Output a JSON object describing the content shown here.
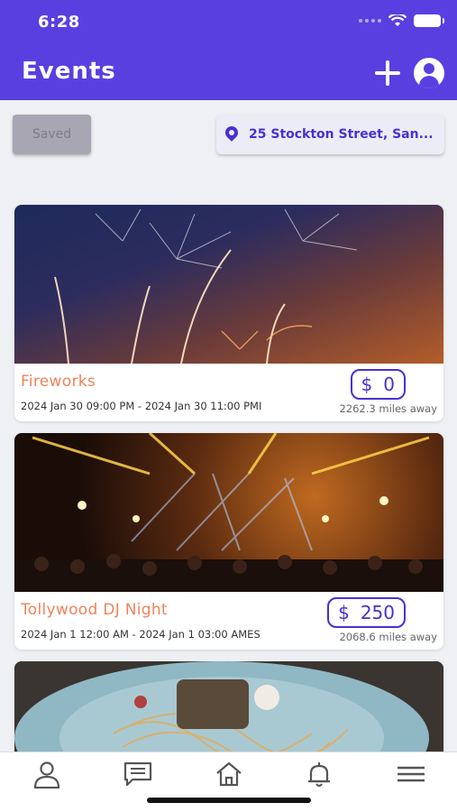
{
  "status_bar": {
    "time": "6:28"
  },
  "header": {
    "title": "Events"
  },
  "filters": {
    "saved_label": "Saved",
    "location": "25 Stockton Street, San..."
  },
  "events": [
    {
      "title": "Fireworks",
      "dates": "2024 Jan 30 09:00 PM  -  2024 Jan 30 11:00 PMI",
      "currency": "$",
      "price": "0",
      "distance": "2262.3  miles away"
    },
    {
      "title": "Tollywood DJ Night",
      "dates": "2024 Jan 1 12:00 AM  -  2024 Jan 1 03:00 AMES",
      "currency": "$",
      "price": "250",
      "distance": "2068.6  miles away"
    }
  ],
  "colors": {
    "header": "#5a3fe0",
    "accent": "#4a2fd4",
    "title_orange": "#f0825a"
  },
  "nav_icons": [
    "profile-icon",
    "chat-icon",
    "home-icon",
    "bell-icon",
    "menu-icon"
  ]
}
